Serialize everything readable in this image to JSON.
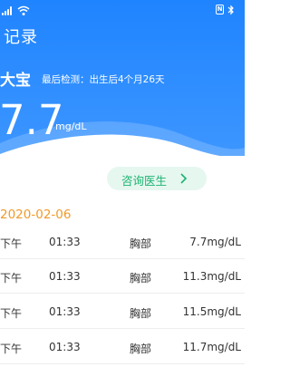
{
  "header": {
    "title": "记录",
    "baby_name": "大宝",
    "last_check": "最后检测：出生后4个月26天",
    "latest_value": "7.7",
    "unit": "mg/dL"
  },
  "consult_button": {
    "label": "咨询医生"
  },
  "date": "2020-02-06",
  "records": [
    {
      "period": "下午",
      "time": "01:33",
      "site": "胸部",
      "value": "7.7mg/dL"
    },
    {
      "period": "下午",
      "time": "01:33",
      "site": "胸部",
      "value": "11.3mg/dL"
    },
    {
      "period": "下午",
      "time": "01:33",
      "site": "胸部",
      "value": "11.5mg/dL"
    },
    {
      "period": "下午",
      "time": "01:33",
      "site": "胸部",
      "value": "11.7mg/dL"
    }
  ],
  "colors": {
    "header_blue": "#2b8bff",
    "consult_green": "#1bb371",
    "date_orange": "#f09a2a"
  }
}
